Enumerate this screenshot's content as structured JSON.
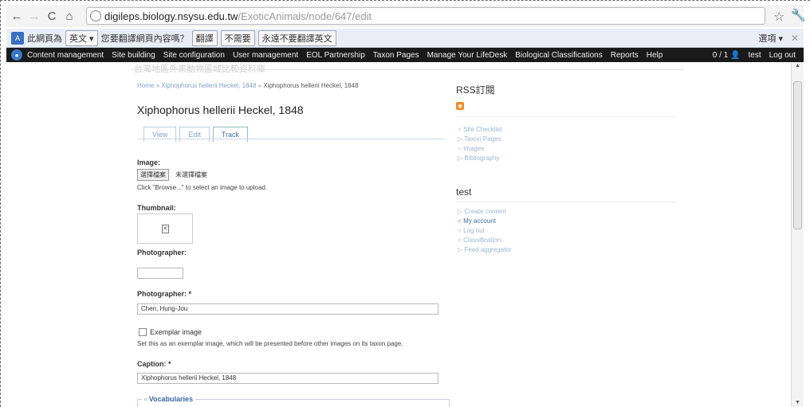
{
  "browser": {
    "url_host": "digileps.biology.nsysu.edu.tw",
    "url_path": "/ExoticAnimals/node/647/edit"
  },
  "translate_bar": {
    "prefix": "此網頁為",
    "language": "英文",
    "question": "您要翻譯網頁內容嗎？",
    "translate_btn": "翻譯",
    "no_btn": "不需要",
    "never_btn": "永遠不要翻譯英文",
    "options": "選項"
  },
  "admin_menu": {
    "items": [
      "Content management",
      "Site building",
      "Site configuration",
      "User management",
      "EOL Partnership",
      "Taxon Pages",
      "Manage Your LifeDesk",
      "Biological Classifications",
      "Reports",
      "Help"
    ],
    "counter": "0 / 1",
    "username": "test",
    "logout": "Log out"
  },
  "page": {
    "header_faded": "台灣地區外來動物區域比較資料庫",
    "breadcrumb_home": "Home",
    "breadcrumb_parent": "Xiphophorus hellerii Heckel, 1848",
    "breadcrumb_current": "Xiphophorus hellerii Heckel, 1848",
    "title": "Xiphophorus hellerii Heckel, 1848",
    "tabs": [
      "View",
      "Edit",
      "Track"
    ]
  },
  "form": {
    "image_label": "Image:",
    "file_button": "選擇檔案",
    "file_none": "未選擇檔案",
    "image_desc": "Click \"Browse...\" to select an image to upload.",
    "thumbnail_label": "Thumbnail:",
    "photographer_label_1": "Photographer:",
    "photographer_value_1": "",
    "photographer_label_2": "Photographer: *",
    "photographer_value_2": "Chen, Hung-Jou",
    "exemplar_label": "Exemplar image",
    "exemplar_desc": "Set this as an exemplar image, which will be presented before other images on its taxon page.",
    "caption_label": "Caption: *",
    "caption_value": "Xiphophorus hellerii Heckel, 1848",
    "vocabularies_legend": "Vocabularies"
  },
  "sidebar": {
    "rss_title": "RSS訂閱",
    "rss_links": [
      "Site Checklist",
      "Taxon Pages",
      "Images",
      "Bibliography"
    ],
    "user_title": "test",
    "user_links": [
      "Create content",
      "My account",
      "Log out",
      "Classification",
      "Feed aggregator"
    ]
  }
}
